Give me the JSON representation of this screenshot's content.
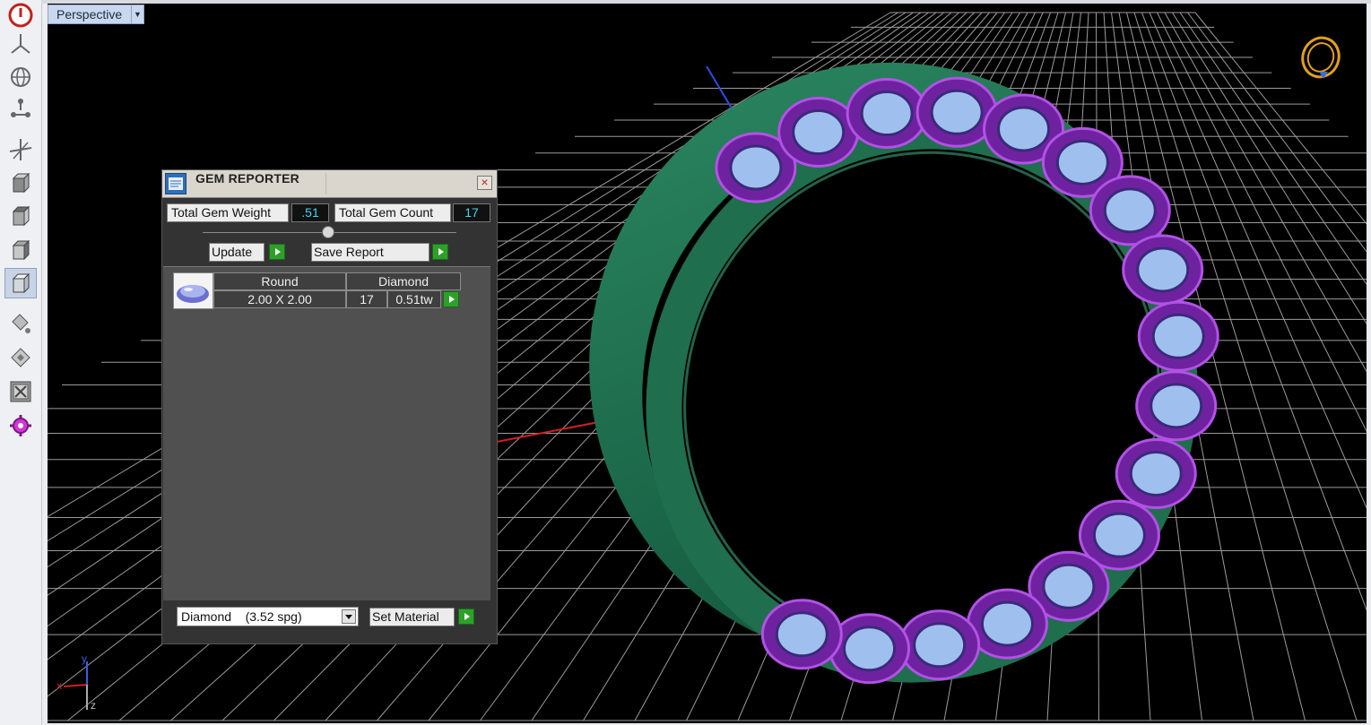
{
  "viewport": {
    "label": "Perspective",
    "axes": {
      "y": "y",
      "x": "x",
      "z": "z"
    }
  },
  "toolbar": {
    "icons": [
      "power-icon",
      "plane-icon",
      "globe-icon",
      "nodes-icon",
      "transform-icon",
      "cube-front-icon",
      "cube-top-icon",
      "cube-right-icon",
      "cube-perspective-icon",
      "bucket-icon",
      "stamp-icon",
      "collapse-icon",
      "settings-gear-icon"
    ]
  },
  "gem_reporter": {
    "title": "GEM REPORTER",
    "close": "×",
    "total_weight_label": "Total Gem Weight",
    "total_weight_value": ".51",
    "total_count_label": "Total Gem Count",
    "total_count_value": "17",
    "update_label": "Update",
    "save_label": "Save Report",
    "table": {
      "headers": [
        "Round",
        "Diamond"
      ],
      "row": {
        "size": "2.00 X 2.00",
        "count": "17",
        "weight": "0.51tw"
      }
    },
    "material": {
      "selected": "Diamond    (3.52 spg)",
      "set_label": "Set Material"
    }
  },
  "colors": {
    "accent_cyan": "#44d7ee",
    "ring_green": "#1f6e4e",
    "setting_purple": "#7a2aa8",
    "gem_blue": "#9fc0ef"
  }
}
